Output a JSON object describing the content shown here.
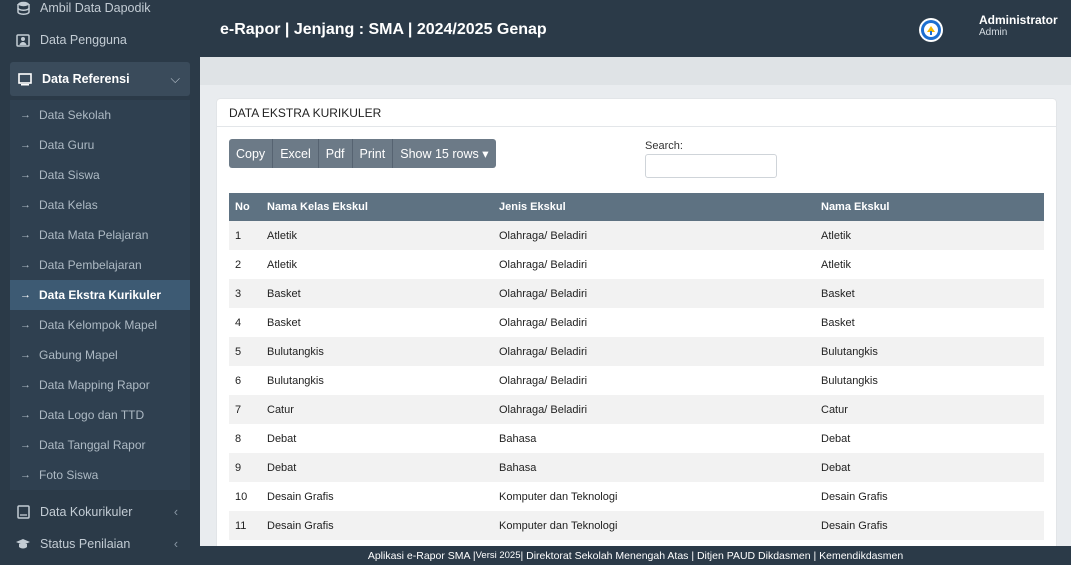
{
  "sidebar": {
    "top_items": [
      {
        "label": "Ambil Data Dapodik",
        "icon": "database-icon"
      },
      {
        "label": "Data Pengguna",
        "icon": "user-card-icon"
      }
    ],
    "group": {
      "label": "Data Referensi",
      "icon": "monitor-icon"
    },
    "sub_items": [
      "Data Sekolah",
      "Data Guru",
      "Data Siswa",
      "Data Kelas",
      "Data Mata Pelajaran",
      "Data Pembelajaran",
      "Data Ekstra Kurikuler",
      "Data Kelompok Mapel",
      "Gabung Mapel",
      "Data Mapping Rapor",
      "Data Logo dan TTD",
      "Data Tanggal Rapor",
      "Foto Siswa"
    ],
    "bottom_items": [
      {
        "label": "Data Kokurikuler",
        "icon": "book-icon"
      },
      {
        "label": "Status Penilaian",
        "icon": "graduation-icon"
      }
    ]
  },
  "topbar": {
    "title": "e-Rapor | Jenjang : SMA | 2024/2025 Genap",
    "user_name": "Administrator",
    "user_role": "Admin"
  },
  "card": {
    "title": "DATA EKSTRA KURIKULER",
    "buttons": [
      "Copy",
      "Excel",
      "Pdf",
      "Print",
      "Show 15 rows ▾"
    ],
    "search_label": "Search:"
  },
  "table": {
    "headers": [
      "No",
      "Nama Kelas Ekskul",
      "Jenis Ekskul",
      "Nama Ekskul"
    ],
    "rows": [
      [
        "1",
        "Atletik",
        "Olahraga/ Beladiri",
        "Atletik"
      ],
      [
        "2",
        "Atletik",
        "Olahraga/ Beladiri",
        "Atletik"
      ],
      [
        "3",
        "Basket",
        "Olahraga/ Beladiri",
        "Basket"
      ],
      [
        "4",
        "Basket",
        "Olahraga/ Beladiri",
        "Basket"
      ],
      [
        "5",
        "Bulutangkis",
        "Olahraga/ Beladiri",
        "Bulutangkis"
      ],
      [
        "6",
        "Bulutangkis",
        "Olahraga/ Beladiri",
        "Bulutangkis"
      ],
      [
        "7",
        "Catur",
        "Olahraga/ Beladiri",
        "Catur"
      ],
      [
        "8",
        "Debat",
        "Bahasa",
        "Debat"
      ],
      [
        "9",
        "Debat",
        "Bahasa",
        "Debat"
      ],
      [
        "10",
        "Desain Grafis",
        "Komputer dan Teknologi",
        "Desain Grafis"
      ],
      [
        "11",
        "Desain Grafis",
        "Komputer dan Teknologi",
        "Desain Grafis"
      ]
    ]
  },
  "footer": {
    "part1": "Aplikasi e-Rapor SMA | ",
    "version": "Versi 2025",
    "part2": " | Direktorat Sekolah Menengah Atas | Ditjen PAUD Dikdasmen | Kemendikdasmen"
  }
}
